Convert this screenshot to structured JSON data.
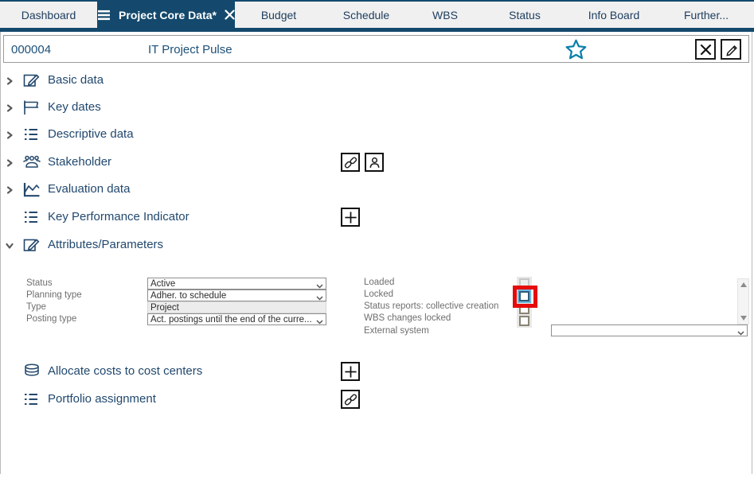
{
  "window": {
    "tabs": [
      {
        "label": "Dashboard",
        "active": false
      },
      {
        "label": "Project Core Data*",
        "active": true
      },
      {
        "label": "Budget",
        "active": false
      },
      {
        "label": "Schedule",
        "active": false
      },
      {
        "label": "WBS",
        "active": false
      },
      {
        "label": "Status",
        "active": false
      },
      {
        "label": "Info Board",
        "active": false
      },
      {
        "label": "Further...",
        "active": false
      }
    ]
  },
  "header": {
    "project_id": "000004",
    "project_title": "IT Project Pulse",
    "favorite_icon": "star-outline",
    "action_icons": [
      "close-icon",
      "edit-pencil-icon"
    ]
  },
  "sections": [
    {
      "label": "Basic data",
      "icon": "edit-square-icon",
      "collapsed": true
    },
    {
      "label": "Key dates",
      "icon": "flag-icon",
      "collapsed": true
    },
    {
      "label": "Descriptive data",
      "icon": "list-icon",
      "collapsed": true
    },
    {
      "label": "Stakeholder",
      "icon": "people-group-icon",
      "collapsed": true,
      "actions": [
        "link-icon",
        "person-icon"
      ]
    },
    {
      "label": "Evaluation data",
      "icon": "area-chart-icon",
      "collapsed": true
    },
    {
      "label": "Key Performance Indicator",
      "icon": "list-icon",
      "actions": [
        "plus-icon"
      ]
    },
    {
      "label": "Attributes/Parameters",
      "icon": "edit-square-icon",
      "collapsed": false
    },
    {
      "label": "Allocate costs to cost centers",
      "icon": "coins-icon",
      "actions": [
        "plus-icon"
      ]
    },
    {
      "label": "Portfolio assignment",
      "icon": "list-icon",
      "actions": [
        "link-icon"
      ]
    }
  ],
  "attributes_form": {
    "fields": [
      {
        "label": "Status",
        "value": "Active",
        "control": "select"
      },
      {
        "label": "Planning type",
        "value": "Adher. to schedule",
        "control": "select"
      },
      {
        "label": "Type",
        "value": "Project",
        "control": "readonly"
      },
      {
        "label": "Posting type",
        "value": "Act. postings until the end of the curre...",
        "control": "select"
      }
    ],
    "checkboxes": [
      {
        "label": "Loaded",
        "checked": false,
        "disabled": true
      },
      {
        "label": "Locked",
        "checked": false,
        "highlighted": true
      },
      {
        "label": "Status reports: collective creation",
        "checked": false
      },
      {
        "label": "WBS changes locked",
        "checked": false
      }
    ],
    "external_system": {
      "label": "External system",
      "value": ""
    }
  },
  "annotation": {
    "type": "highlight-box",
    "target": "locked-checkbox",
    "color": "#e60b0b"
  },
  "colors": {
    "accent_navy": "#14496d",
    "text_navy": "#21486e",
    "header_text": "#1d5078",
    "star_teal": "#0e7fab",
    "tabbar_bg": "#f0f0f0",
    "highlight_red": "#e60b0b"
  }
}
